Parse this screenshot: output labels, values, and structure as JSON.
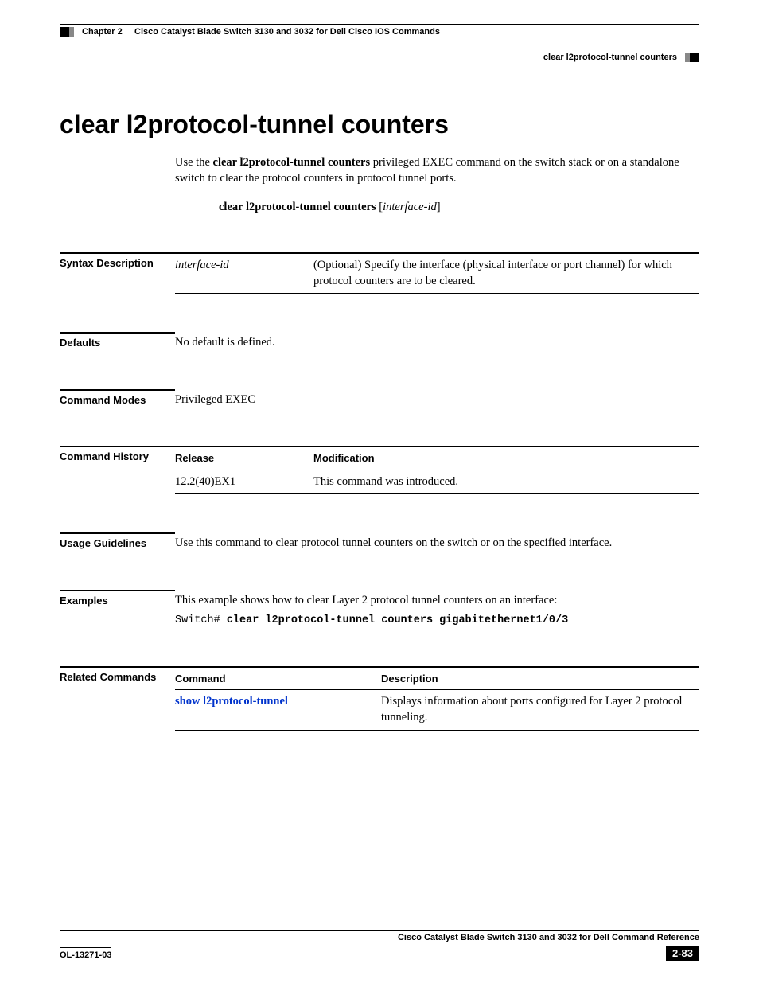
{
  "header": {
    "chapter": "Chapter 2",
    "chapter_title": "Cisco Catalyst Blade Switch 3130 and 3032 for Dell Cisco IOS Commands",
    "running_head": "clear l2protocol-tunnel counters"
  },
  "title": "clear l2protocol-tunnel counters",
  "intro": {
    "prefix": "Use the ",
    "cmd": "clear l2protocol-tunnel counters",
    "suffix": " privileged EXEC command on the switch stack or on a standalone switch to clear the protocol counters in protocol tunnel ports."
  },
  "syntax_line": {
    "cmd": "clear l2protocol-tunnel counters",
    "arg": "interface-id"
  },
  "syntax_description": {
    "label": "Syntax Description",
    "rows": [
      {
        "arg": "interface-id",
        "desc": "(Optional) Specify the interface (physical interface or port channel) for which protocol counters are to be cleared."
      }
    ]
  },
  "defaults": {
    "label": "Defaults",
    "text": "No default is defined."
  },
  "command_modes": {
    "label": "Command Modes",
    "text": "Privileged EXEC"
  },
  "command_history": {
    "label": "Command History",
    "head_release": "Release",
    "head_mod": "Modification",
    "rows": [
      {
        "release": "12.2(40)EX1",
        "mod": "This command was introduced."
      }
    ]
  },
  "usage": {
    "label": "Usage Guidelines",
    "text": "Use this command to clear protocol tunnel counters on the switch or on the specified interface."
  },
  "examples": {
    "label": "Examples",
    "intro": "This example shows how to clear Layer 2 protocol tunnel counters on an interface:",
    "prompt": "Switch# ",
    "cmd": "clear l2protocol-tunnel counters gigabitethernet1/0/3"
  },
  "related": {
    "label": "Related Commands",
    "head_cmd": "Command",
    "head_desc": "Description",
    "rows": [
      {
        "cmd": "show l2protocol-tunnel",
        "desc": "Displays information about ports configured for Layer 2 protocol tunneling."
      }
    ]
  },
  "footer": {
    "book": "Cisco Catalyst Blade Switch 3130 and 3032 for Dell Command Reference",
    "doc_id": "OL-13271-03",
    "page": "2-83"
  }
}
